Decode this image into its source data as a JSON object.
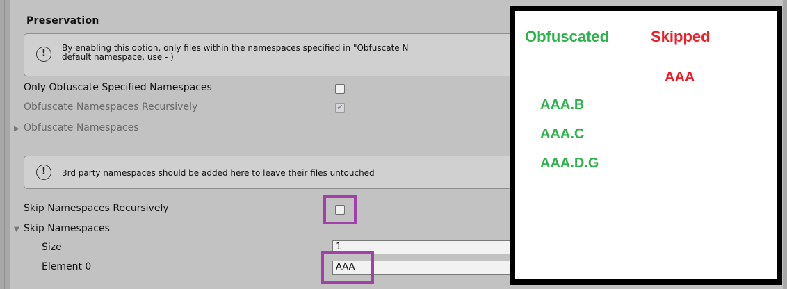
{
  "section": {
    "title": "Preservation",
    "help1": "By enabling this option, only files within the namespaces specified in \"Obfuscate N\ndefault namespace, use - )",
    "only_obfuscate_label": "Only Obfuscate Specified Namespaces",
    "obfuscate_recursive_label": "Obfuscate Namespaces Recursively",
    "obfuscate_namespaces_label": "Obfuscate Namespaces",
    "help2": "3rd party namespaces should be added here to leave their files untouched",
    "skip_recursive_label": "Skip Namespaces Recursively",
    "skip_namespaces_label": "Skip Namespaces",
    "size_label": "Size",
    "size_value": "1",
    "element0_label": "Element 0",
    "element0_value": "AAA"
  },
  "checks": {
    "only_obfuscate": false,
    "obfuscate_recursive": true,
    "skip_recursive": false
  },
  "icons": {
    "info": "info-icon",
    "foldout_collapsed": "triangle-right-icon",
    "foldout_expanded": "triangle-down-icon",
    "check": "check-icon"
  },
  "result_panel": {
    "obfuscated_heading": "Obfuscated",
    "skipped_heading": "Skipped",
    "skipped_items": [
      "AAA"
    ],
    "obfuscated_items": [
      "AAA.B",
      "AAA.C",
      "AAA.D.G"
    ]
  },
  "colors": {
    "obfuscated": "#2cb34a",
    "skipped": "#ee1c25",
    "highlight": "#a040a8"
  }
}
